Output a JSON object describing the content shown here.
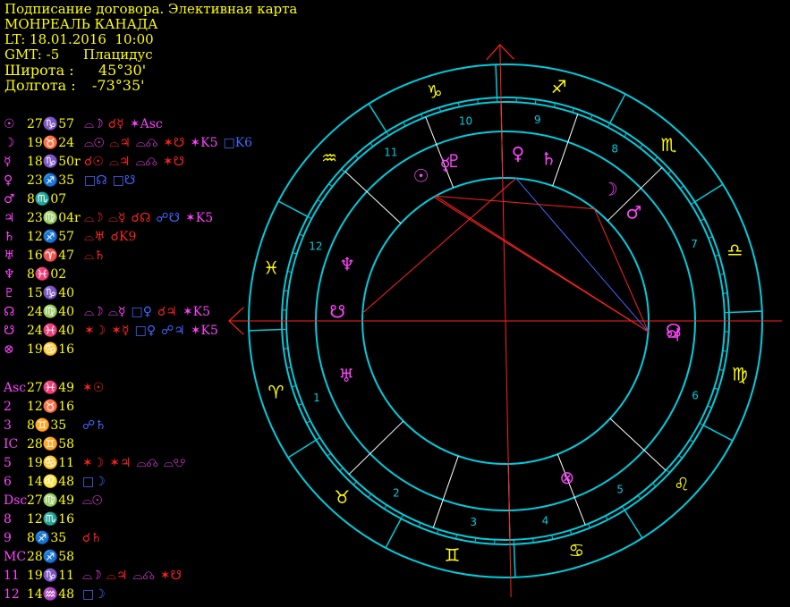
{
  "header": {
    "title": "Подписание договора. Элективная карта",
    "location": "МОНРЕАЛЬ КАНАДА",
    "lt": "LT: 18.01.2016  10:00",
    "gmt": "GMT: -5",
    "house_system": "Плацидус",
    "lat_label": "Широта :",
    "lat_value": "45°30'",
    "lon_label": "Долгота :",
    "lon_value": "-73°35'"
  },
  "colors": {
    "ring": "#00ccdd",
    "sign": "#ffff00",
    "planet": "#ff44ff",
    "aspect_red": "#ff2222",
    "aspect_blue": "#4466ff",
    "axis": "#ff2222"
  },
  "planets": [
    {
      "glyph": "☉",
      "pos": "27♑57",
      "aspects": [
        {
          "t": "⌓☽",
          "c": "mag"
        },
        {
          "t": "☌☿",
          "c": "red"
        },
        {
          "t": "✶Asc",
          "c": "mag"
        }
      ]
    },
    {
      "glyph": "☽",
      "pos": "19♉24",
      "aspects": [
        {
          "t": "⌓☉",
          "c": "mag"
        },
        {
          "t": "⌓♃",
          "c": "red"
        },
        {
          "t": "⌓☊",
          "c": "mag"
        },
        {
          "t": "✶☋",
          "c": "red"
        },
        {
          "t": "✶K5",
          "c": "mag"
        },
        {
          "t": "□K6",
          "c": "blu"
        }
      ]
    },
    {
      "glyph": "☿",
      "pos": "18♑50r",
      "aspects": [
        {
          "t": "☌☉",
          "c": "red"
        },
        {
          "t": "⌓♃",
          "c": "red"
        },
        {
          "t": "⌓☊",
          "c": "mag"
        },
        {
          "t": "✶☋",
          "c": "red"
        }
      ]
    },
    {
      "glyph": "♀",
      "pos": "23♐35",
      "aspects": [
        {
          "t": "□☊",
          "c": "blu"
        },
        {
          "t": "□☋",
          "c": "blu"
        }
      ]
    },
    {
      "glyph": "♂",
      "pos": "8♏07",
      "aspects": []
    },
    {
      "glyph": "♃",
      "pos": "23♍04r",
      "aspects": [
        {
          "t": "⌓☽",
          "c": "red"
        },
        {
          "t": "⌓☿",
          "c": "red"
        },
        {
          "t": "☌☊",
          "c": "red"
        },
        {
          "t": "☍☋",
          "c": "blu"
        },
        {
          "t": "✶K5",
          "c": "mag"
        }
      ]
    },
    {
      "glyph": "♄",
      "pos": "12♐57",
      "aspects": [
        {
          "t": "⌓♅",
          "c": "red"
        },
        {
          "t": "☌K9",
          "c": "red"
        }
      ]
    },
    {
      "glyph": "♅",
      "pos": "16♈47",
      "aspects": [
        {
          "t": "⌓♄",
          "c": "red"
        }
      ]
    },
    {
      "glyph": "♆",
      "pos": "8♓02",
      "aspects": []
    },
    {
      "glyph": "♇",
      "pos": "15♑40",
      "aspects": []
    },
    {
      "glyph": "☊",
      "pos": "24♍40",
      "aspects": [
        {
          "t": "⌓☽",
          "c": "mag"
        },
        {
          "t": "⌓☿",
          "c": "mag"
        },
        {
          "t": "□♀",
          "c": "blu"
        },
        {
          "t": "☌♃",
          "c": "red"
        },
        {
          "t": "✶K5",
          "c": "mag"
        }
      ]
    },
    {
      "glyph": "☋",
      "pos": "24♓40",
      "aspects": [
        {
          "t": "✶☽",
          "c": "red"
        },
        {
          "t": "✶☿",
          "c": "red"
        },
        {
          "t": "□♀",
          "c": "blu"
        },
        {
          "t": "☍♃",
          "c": "blu"
        },
        {
          "t": "✶K5",
          "c": "mag"
        }
      ]
    },
    {
      "glyph": "⊗",
      "pos": "19♋16",
      "aspects": []
    }
  ],
  "houses": [
    {
      "label": "Asc",
      "pos": "27♓49",
      "aspects": [
        {
          "t": "✶☉",
          "c": "red"
        }
      ]
    },
    {
      "label": "2",
      "pos": "12♉16",
      "aspects": []
    },
    {
      "label": "3",
      "pos": "8♊35",
      "aspects": [
        {
          "t": "☍♄",
          "c": "blu"
        }
      ]
    },
    {
      "label": "IC",
      "pos": "28♊58",
      "aspects": []
    },
    {
      "label": "5",
      "pos": "19♋11",
      "aspects": [
        {
          "t": "✶☽",
          "c": "red"
        },
        {
          "t": "✶♃",
          "c": "red"
        },
        {
          "t": "⌓☊",
          "c": "mag"
        },
        {
          "t": "⌓☋",
          "c": "mag"
        }
      ]
    },
    {
      "label": "6",
      "pos": "14♌48",
      "aspects": [
        {
          "t": "□☽",
          "c": "blu"
        }
      ]
    },
    {
      "label": "Dsc",
      "pos": "27♍49",
      "aspects": [
        {
          "t": "⌓☉",
          "c": "mag"
        }
      ]
    },
    {
      "label": "8",
      "pos": "12♏16",
      "aspects": []
    },
    {
      "label": "9",
      "pos": "8♐35",
      "aspects": [
        {
          "t": "☌♄",
          "c": "red"
        }
      ]
    },
    {
      "label": "MC",
      "pos": "28♐58",
      "aspects": []
    },
    {
      "label": "11",
      "pos": "19♑11",
      "aspects": [
        {
          "t": "⌓☽",
          "c": "mag"
        },
        {
          "t": "⌓♃",
          "c": "red"
        },
        {
          "t": "⌓☊",
          "c": "mag"
        },
        {
          "t": "✶☋",
          "c": "red"
        }
      ]
    },
    {
      "label": "12",
      "pos": "14♒48",
      "aspects": [
        {
          "t": "□☽",
          "c": "blu"
        }
      ]
    }
  ],
  "wheel": {
    "asc_longitude": 357.82,
    "house_cusps": [
      357.82,
      42.27,
      68.58,
      88.97,
      109.18,
      134.8,
      177.82,
      222.27,
      248.58,
      268.97,
      289.18,
      314.8
    ],
    "house_numbers": [
      "1",
      "2",
      "3",
      "4",
      "5",
      "6",
      "7",
      "8",
      "9",
      "10",
      "11",
      "12"
    ],
    "signs": [
      "♈",
      "♉",
      "♊",
      "♋",
      "♌",
      "♍",
      "♎",
      "♏",
      "♐",
      "♑",
      "♒",
      "♓"
    ],
    "bodies": [
      {
        "glyph": "☉",
        "lon": 297.95
      },
      {
        "glyph": "☽",
        "lon": 229.4
      },
      {
        "glyph": "☿",
        "lon": 288.83
      },
      {
        "glyph": "♀",
        "lon": 263.58
      },
      {
        "glyph": "♂",
        "lon": 218.12
      },
      {
        "glyph": "♃",
        "lon": 173.07
      },
      {
        "glyph": "♄",
        "lon": 252.95
      },
      {
        "glyph": "♅",
        "lon": 16.78
      },
      {
        "glyph": "♆",
        "lon": 338.03
      },
      {
        "glyph": "♇",
        "lon": 285.67
      },
      {
        "glyph": "☊",
        "lon": 174.67
      },
      {
        "glyph": "☋",
        "lon": 354.67
      },
      {
        "glyph": "⊗",
        "lon": 109.27
      }
    ],
    "aspect_lines": [
      {
        "a": 173.5,
        "b": 229.4,
        "c": "red"
      },
      {
        "a": 173.5,
        "b": 297.0,
        "c": "red"
      },
      {
        "a": 173.5,
        "b": 263.58,
        "c": "blu"
      },
      {
        "a": 229.4,
        "b": 297.0,
        "c": "red"
      },
      {
        "a": 263.58,
        "b": 354.67,
        "c": "red"
      },
      {
        "a": 173.5,
        "b": 297.8,
        "c": "red"
      }
    ]
  }
}
